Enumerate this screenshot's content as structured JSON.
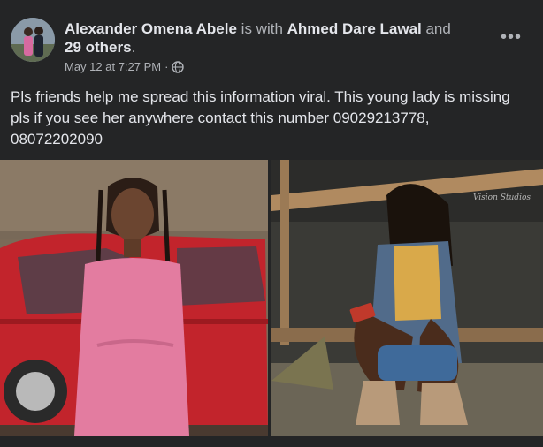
{
  "post": {
    "author": "Alexander Omena Abele",
    "with_text": " is with ",
    "tagged": "Ahmed Dare Lawal",
    "and_text": " and ",
    "others": "29 others",
    "period": ".",
    "timestamp": "May 12 at 7:27 PM",
    "separator": "·",
    "privacy_icon": "globe-icon",
    "more_icon": "more-options-icon",
    "more_label": "•••",
    "text_line1": "Pls friends help me spread this information viral. This young lady is missing",
    "text_line2": "pls if you see her anywhere contact this number 09029213778,",
    "text_line3": "08072202090"
  },
  "colors": {
    "background": "#242526",
    "primary_text": "#e4e6eb",
    "secondary_text": "#b0b3b8"
  }
}
